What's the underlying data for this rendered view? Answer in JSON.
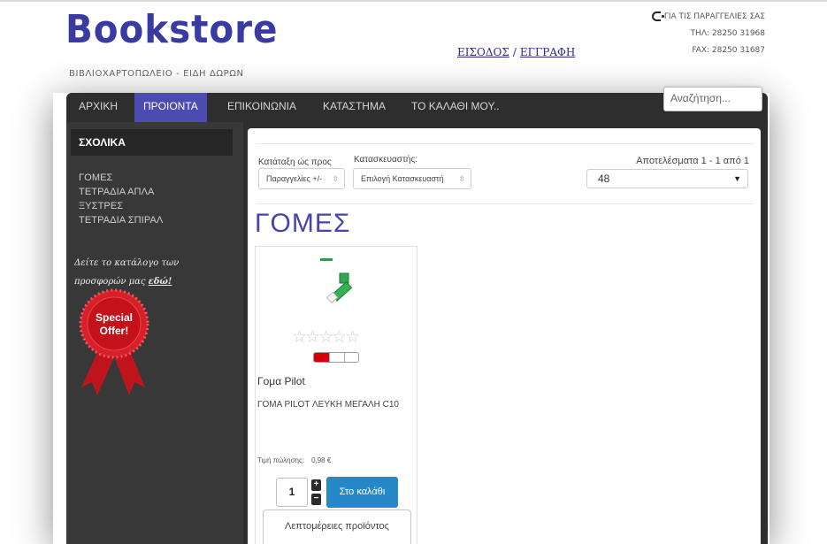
{
  "header": {
    "logo": "Bookstore",
    "tagline": "ΒΙΒΛΙΟΧΑΡΤΟΠΩΛΕΙΟ - ΕΙΔΗ ΔΩΡΩΝ",
    "login_label": "ΕΙΣΟΔΟΣ",
    "separator": "/",
    "register_label": "ΕΓΓΡΑΦΗ",
    "contact": {
      "title": "ΓΙΑ ΤΙΣ ΠΑΡΑΓΓΕΛΙΕΣ ΣΑΣ",
      "phone": "ΤΗΛ: 28250 31968",
      "fax": "FAX: 28250 31687",
      "icon": "phone-icon"
    }
  },
  "nav": {
    "items": [
      {
        "label": "ΑΡΧΙΚΗ"
      },
      {
        "label": "ΠΡΟΙΟΝΤΑ"
      },
      {
        "label": "ΕΠΙΚΟΙΝΩΝΙΑ"
      },
      {
        "label": "ΚΑΤΑΣΤΗΜΑ"
      },
      {
        "label": "ΤΟ ΚΑΛΑΘΙ ΜΟΥ.."
      }
    ],
    "search_placeholder": "Αναζήτηση...",
    "accent_color": "#4b4bb0"
  },
  "sidebar": {
    "header": "ΣΧΟΛΙΚΑ",
    "items": [
      "ΓΟΜΕΣ",
      "ΤΕΤΡΑΔΙΑ ΑΠΛΑ",
      "ΞΥΣΤΡΕΣ",
      "ΤΕΤΡΑΔΙΑ ΣΠΙΡΑΛ"
    ],
    "catalog_text": "Δείτε το κατάλογο των προσφορών μας",
    "catalog_link": "εδώ!",
    "badge_line1": "Special",
    "badge_line2": "Offer!"
  },
  "toolbar": {
    "sort_label": "Κατάταξη ώς προς",
    "sort_value": "Παραγγελίες +/-",
    "manufacturer_label": "Κατασκευαστής:",
    "manufacturer_value": "Επιλογή Κατασκευαστή",
    "results": "Αποτελέσματα 1 - 1 από 1",
    "per_page": "48"
  },
  "category_title": "ΓΟΜΕΣ",
  "product": {
    "name": "Γομα Pilot",
    "description": "ΓΟΜΑ PILOT ΛΕΥΚΗ ΜΕΓΑΛΗ C10",
    "price_label": "Τιμή πώλησης:",
    "price_value": "0,98 €",
    "quantity": "1",
    "qty_plus": "+",
    "qty_minus": "−",
    "add_to_cart": "Στο καλάθι",
    "details": "Λεπτομέρειες προϊόντος",
    "stars": "☆☆☆☆☆",
    "rating_fill": 0.33,
    "rating_color": "#d6000b",
    "cart_color": "#2688c6"
  }
}
